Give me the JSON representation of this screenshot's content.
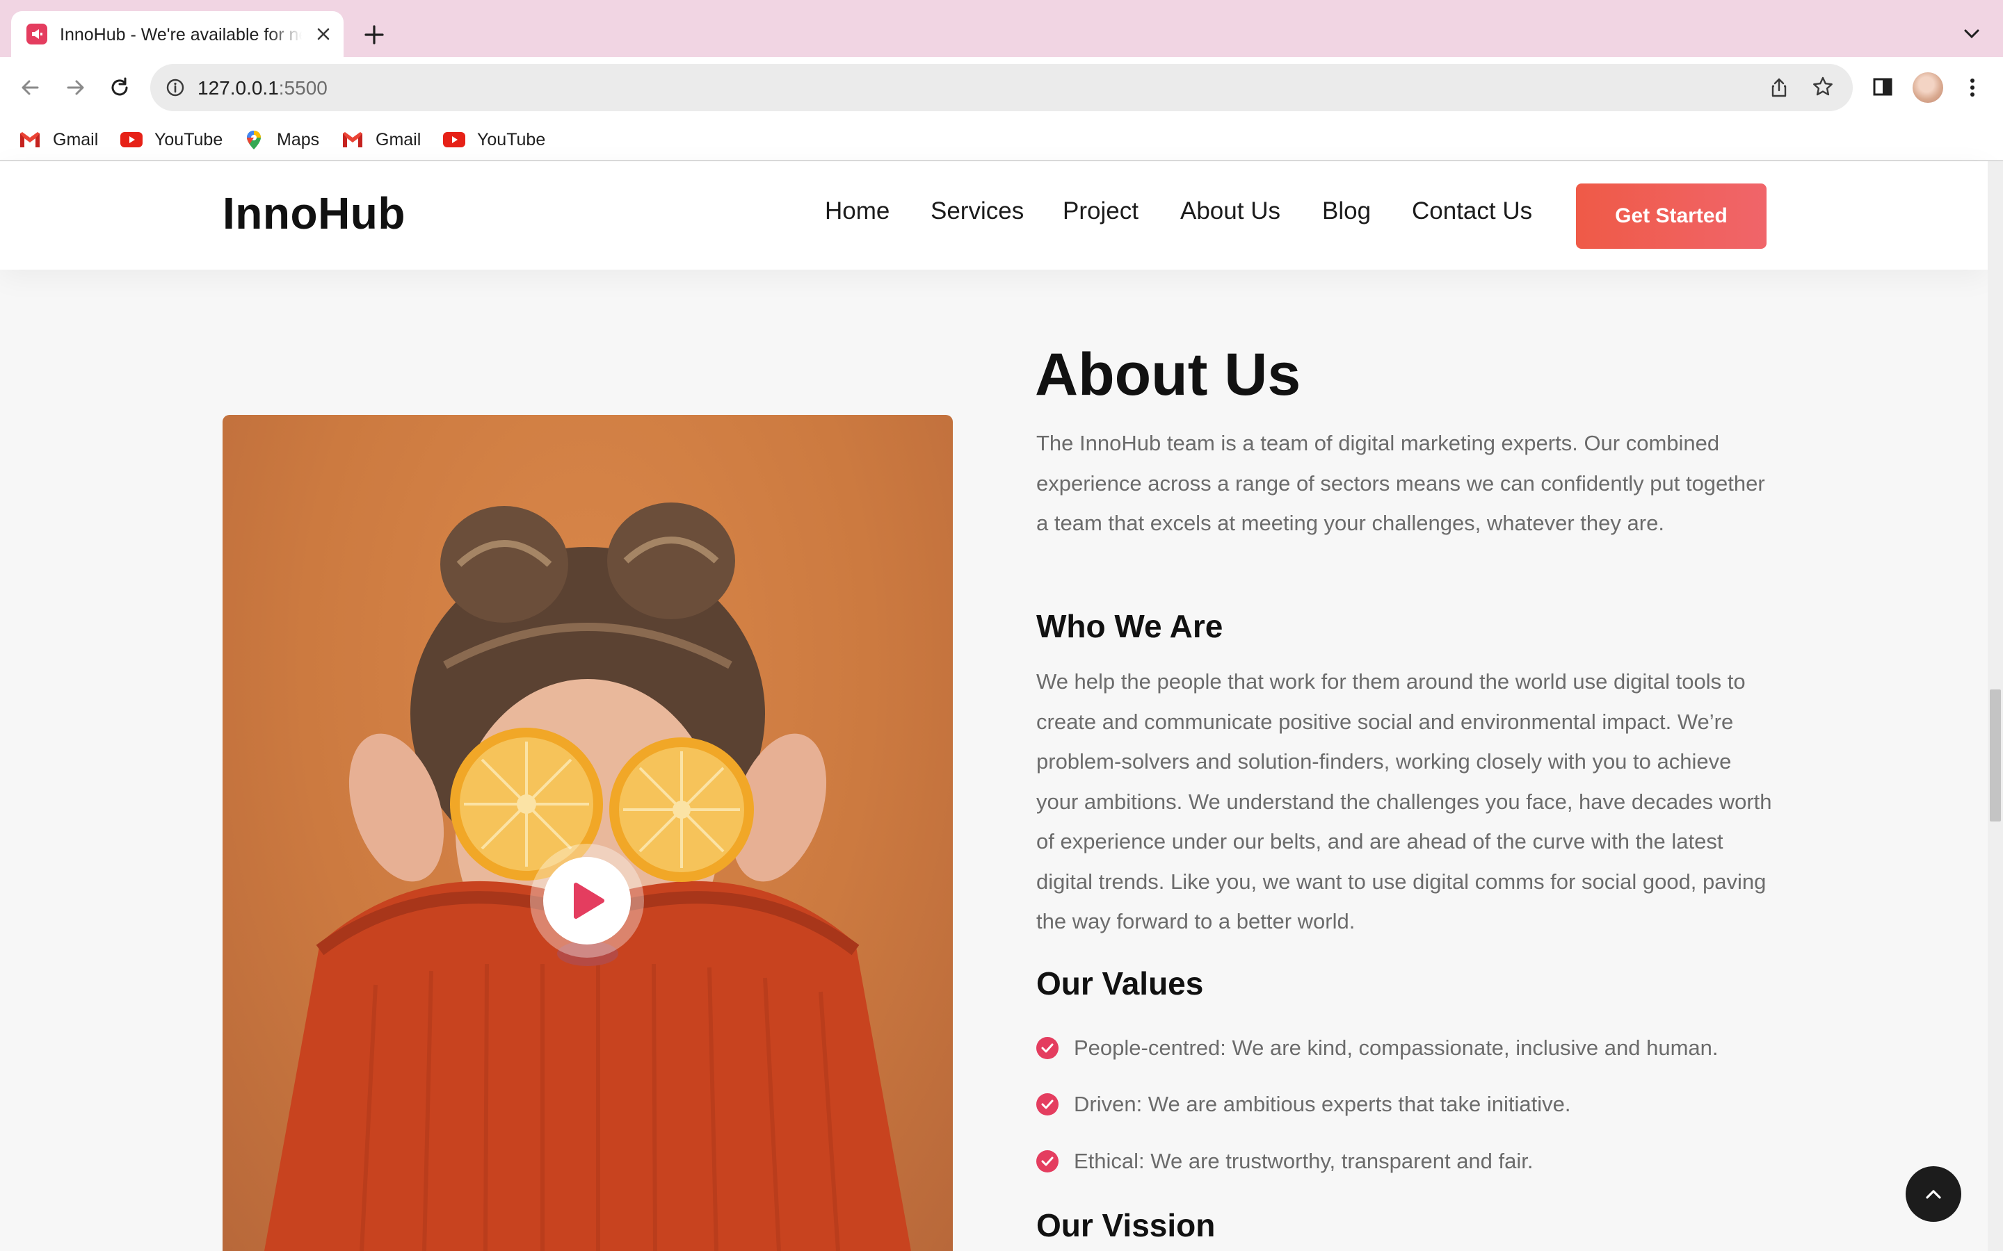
{
  "browser": {
    "tab_title": "InnoHub - We're available for new projects",
    "url_host": "127.0.0.1",
    "url_port": ":5500",
    "bookmarks": [
      {
        "label": "Gmail",
        "icon": "gmail-icon"
      },
      {
        "label": "YouTube",
        "icon": "youtube-icon"
      },
      {
        "label": "Maps",
        "icon": "maps-icon"
      },
      {
        "label": "Gmail",
        "icon": "gmail-icon"
      },
      {
        "label": "YouTube",
        "icon": "youtube-icon"
      }
    ]
  },
  "header": {
    "logo": "InnoHub",
    "nav": [
      "Home",
      "Services",
      "Project",
      "About Us",
      "Blog",
      "Contact Us"
    ],
    "cta": "Get Started"
  },
  "about": {
    "title": "About Us",
    "intro": "The InnoHub team is a team of digital marketing experts. Our combined experience across a range of sectors means we can confidently put together a team that excels at meeting your challenges, whatever they are.",
    "who_title": "Who We Are",
    "who_text": "We help the people that work for them around the world use digital tools to create and communicate positive social and environmental impact. We’re problem-solvers and solution-finders, working closely with you to achieve your ambitions. We understand the challenges you face, have decades worth of experience under our belts, and are ahead of the curve with the latest digital trends. Like you, we want to use digital comms for social good, paving the way forward to a better world.",
    "values_title": "Our Values",
    "values": [
      "People-centred: We are kind, compassionate, inclusive and human.",
      "Driven: We are ambitious experts that take initiative.",
      "Ethical: We are trustworthy, transparent and fair."
    ],
    "vision_title": "Our Vission"
  },
  "colors": {
    "accent": "#e43d5f",
    "cta_gradient_start": "#ef5a47",
    "cta_gradient_end": "#f0656a",
    "heading": "#111111",
    "body_text": "#6b6b6b"
  }
}
